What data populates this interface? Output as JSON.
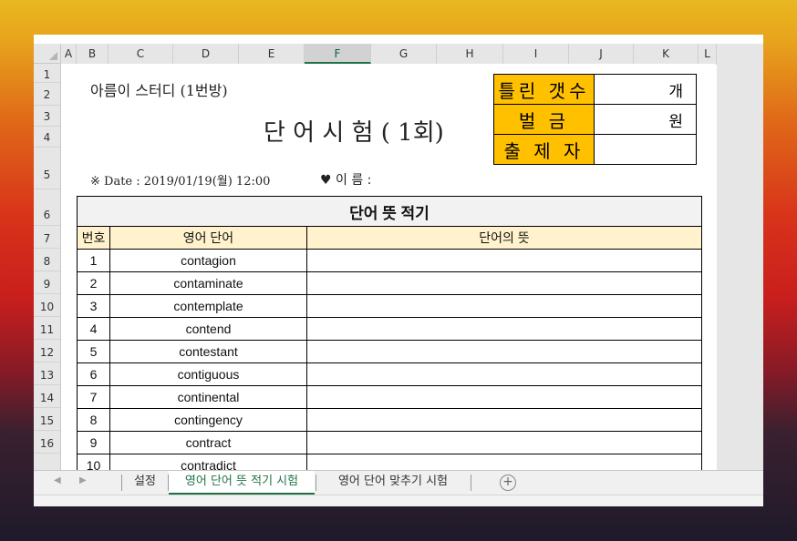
{
  "columns": [
    "A",
    "B",
    "C",
    "D",
    "E",
    "F",
    "G",
    "H",
    "I",
    "J",
    "K",
    "L"
  ],
  "rows": [
    "1",
    "2",
    "3",
    "4",
    "5",
    "6",
    "7",
    "8",
    "9",
    "10",
    "11",
    "12",
    "13",
    "14",
    "15",
    "16"
  ],
  "sheet": {
    "study_name": "아름이 스터디 (1번방)",
    "test_title": "단 어 시 험 ( 1회)",
    "date_line": "※ Date : 2019/01/19(월) 12:00",
    "name_label": "♥ 이 름 :",
    "info": [
      {
        "label": "틀린 갯수",
        "value": "개"
      },
      {
        "label": "벌 금",
        "value": "원"
      },
      {
        "label": "출 제 자",
        "value": ""
      }
    ],
    "banner": "단어 뜻 적기",
    "headers": {
      "num": "번호",
      "word": "영어 단어",
      "meaning": "단어의 뜻"
    },
    "words": [
      {
        "num": "1",
        "word": "contagion"
      },
      {
        "num": "2",
        "word": "contaminate"
      },
      {
        "num": "3",
        "word": "contemplate"
      },
      {
        "num": "4",
        "word": "contend"
      },
      {
        "num": "5",
        "word": "contestant"
      },
      {
        "num": "6",
        "word": "contiguous"
      },
      {
        "num": "7",
        "word": "continental"
      },
      {
        "num": "8",
        "word": "contingency"
      },
      {
        "num": "9",
        "word": "contract"
      },
      {
        "num": "10",
        "word": "contradict"
      }
    ]
  },
  "tabs": [
    {
      "label": "설정"
    },
    {
      "label": "영어 단어 뜻 적기 시험"
    },
    {
      "label": "영어 단어 맞추기 시험"
    }
  ],
  "add_sheet_symbol": "+",
  "nav_left": "◀",
  "nav_right": "▶",
  "colors": {
    "accent": "#217346",
    "orange": "#ffc000",
    "header_fill": "#fff2cc"
  }
}
